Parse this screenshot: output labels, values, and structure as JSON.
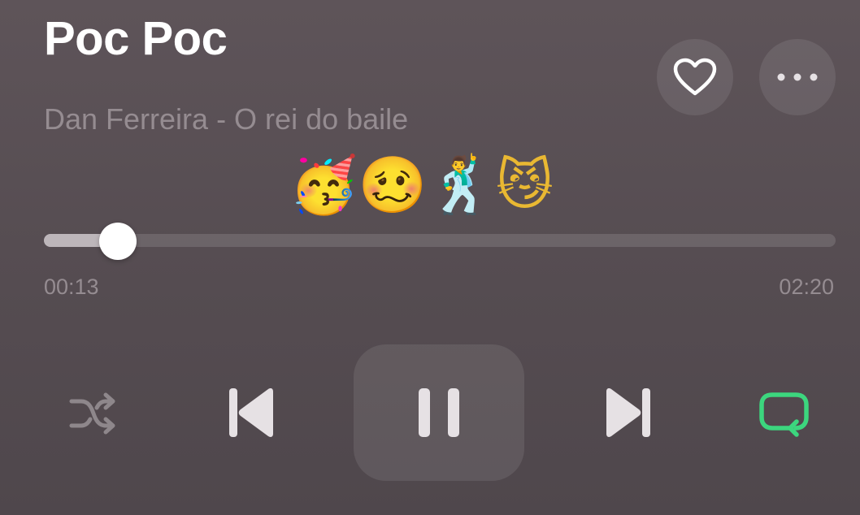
{
  "track": {
    "title": "Poc Poc",
    "subtitle": "Dan Ferreira - O rei do baile",
    "emoji_line": "🥳🥴🕺😼"
  },
  "progress": {
    "elapsed": "00:13",
    "total": "02:20",
    "fraction": 0.093
  },
  "controls": {
    "favorite_icon": "heart-outline-icon",
    "more_icon": "ellipsis-icon",
    "shuffle_icon": "shuffle-icon",
    "previous_icon": "skip-back-icon",
    "play_state": "playing",
    "pause_icon": "pause-icon",
    "next_icon": "skip-forward-icon",
    "repeat_icon": "repeat-icon",
    "repeat_active": true
  },
  "colors": {
    "accent_green": "#3cd67e",
    "icon_dim": "#8e878b",
    "icon_light": "#e6e1e4"
  }
}
